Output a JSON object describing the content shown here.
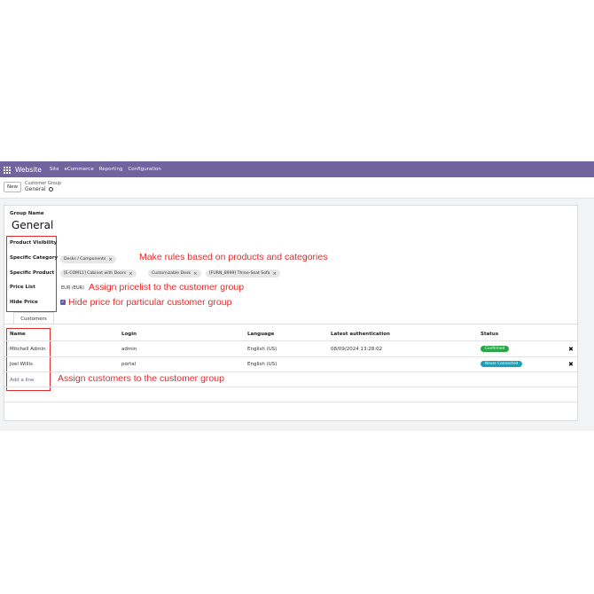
{
  "topbar": {
    "brand": "Website",
    "menu": [
      "Site",
      "eCommerce",
      "Reporting",
      "Configuration"
    ]
  },
  "control": {
    "new_label": "New",
    "breadcrumb_parent": "Customer Group",
    "breadcrumb_current": "General"
  },
  "form": {
    "group_name_label": "Group Name",
    "group_name": "General",
    "fields": {
      "product_visibility": "Product Visibility",
      "specific_category": "Specific Category",
      "specific_product": "Specific Product",
      "price_list": "Price List",
      "hide_price": "Hide Price"
    },
    "category_tags": [
      "Desks / Components"
    ],
    "product_tags": [
      "[E-COM11] Cabinet with Doors",
      "Customizable Desk",
      "[FURN_8999] Three-Seat Sofa"
    ],
    "pricelist_value": "EUR (EUR)",
    "hide_price_checked": true
  },
  "annotations": {
    "rules": "Make rules based on products and categories",
    "pricelist": "Assign pricelist to the customer group",
    "hide": "Hide price for particular customer group",
    "customers": "Assign customers to the customer group"
  },
  "tabs": {
    "customers": "Customers"
  },
  "table": {
    "headers": {
      "name": "Name",
      "login": "Login",
      "language": "Language",
      "auth": "Latest authentication",
      "status": "Status"
    },
    "rows": [
      {
        "name": "Mitchell Admin",
        "login": "admin",
        "language": "English (US)",
        "auth": "08/09/2024 13:28:02",
        "status": "Confirmed"
      },
      {
        "name": "Joel Willis",
        "login": "portal",
        "language": "English (US)",
        "auth": "",
        "status": "Never Connected"
      }
    ],
    "add_line": "Add a line"
  },
  "colors": {
    "topbar": "#71639e",
    "annotation": "#e32b2b",
    "confirmed": "#28a745",
    "never_connected": "#17a2b8"
  }
}
